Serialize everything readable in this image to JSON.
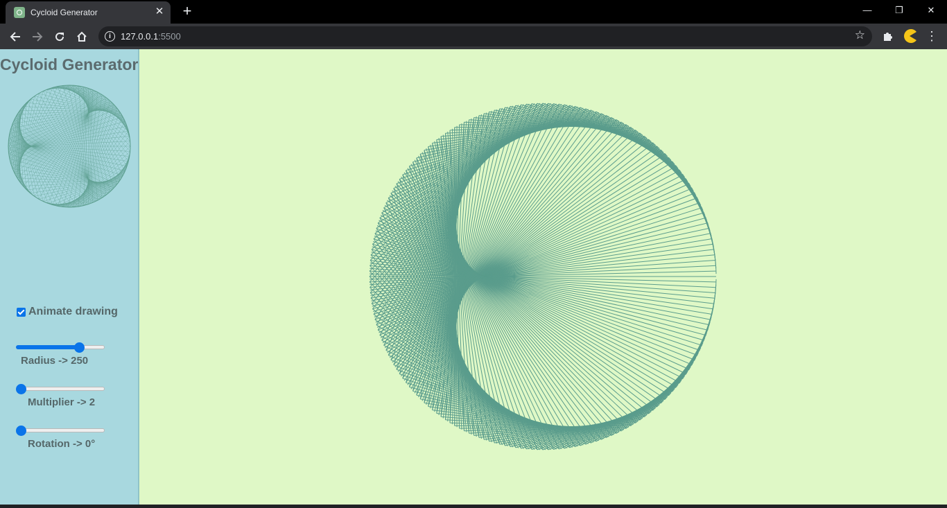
{
  "browser": {
    "tab_title": "Cycloid Generator",
    "tab_close": "✕",
    "new_tab": "+",
    "url_host": "127.0.0.1",
    "url_port": ":5500",
    "window_controls": {
      "minimize": "—",
      "restore": "❐",
      "close": "✕"
    },
    "icons": {
      "back": "back-arrow-icon",
      "forward": "forward-arrow-icon",
      "reload": "reload-icon",
      "home": "home-icon",
      "info": "info-icon",
      "bookmark": "star-icon",
      "extensions": "puzzle-icon",
      "profile": "pacman-avatar-icon",
      "menu": "kebab-menu-icon"
    }
  },
  "app": {
    "title": "Cycloid Generator",
    "animate_label": "Animate drawing",
    "animate_checked": true,
    "radius": {
      "label": "Radius -> 250",
      "value": 250,
      "min": 0,
      "max": 350
    },
    "multiplier": {
      "label": "Multiplier -> 2",
      "value": 2,
      "min": 2,
      "max": 100
    },
    "rotation": {
      "label": "Rotation -> 0°",
      "value": 0,
      "min": 0,
      "max": 360
    },
    "colors": {
      "sidebar_bg": "#a8d8df",
      "canvas_bg": "#dff8c6",
      "stroke": "#5a9c8c",
      "accent": "#0a74e9",
      "text": "#556769"
    }
  }
}
